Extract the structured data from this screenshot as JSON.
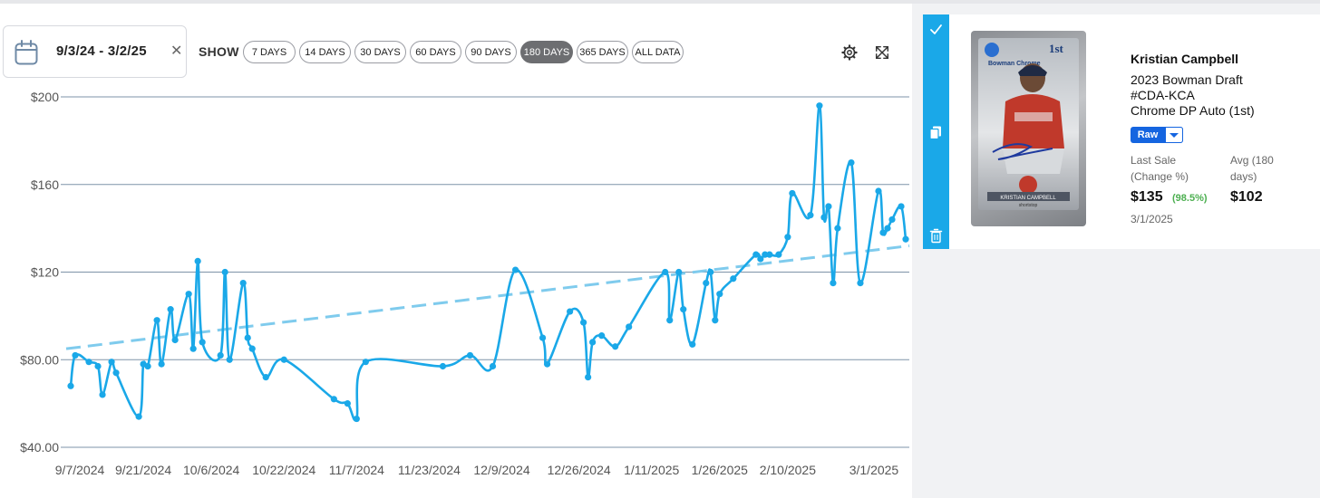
{
  "date_range": {
    "label": "9/3/24 - 3/2/25"
  },
  "filter": {
    "show_label": "SHOW",
    "options": [
      "7 DAYS",
      "14 DAYS",
      "30 DAYS",
      "60 DAYS",
      "90 DAYS",
      "180 DAYS",
      "365 DAYS",
      "ALL DATA"
    ],
    "selected": "180 DAYS"
  },
  "icons": {
    "calendar": "calendar-icon",
    "clear": "close-icon",
    "settings": "gear-icon",
    "expand": "expand-icon",
    "check": "check-icon",
    "copy": "copy-icon",
    "delete": "trash-icon"
  },
  "colors": {
    "line": "#1aa8e8",
    "trend": "#7fcbed",
    "grid": "#7e93a8",
    "accent_bar": "#1aa8e8",
    "raw_button": "#1565e0",
    "change_positive": "#4caf50"
  },
  "chart_data": {
    "type": "line",
    "title": "",
    "xlabel": "",
    "ylabel": "",
    "ylim": [
      40,
      200
    ],
    "yticks": [
      "$40.00",
      "$80.00",
      "$120",
      "$160",
      "$200"
    ],
    "yticks_values": [
      40,
      80,
      120,
      160,
      200
    ],
    "xlim": [
      "2024-09-04",
      "2025-03-04"
    ],
    "xticks": [
      "9/7/2024",
      "9/21/2024",
      "10/6/2024",
      "10/22/2024",
      "11/7/2024",
      "11/23/2024",
      "12/9/2024",
      "12/26/2024",
      "1/11/2025",
      "1/26/2025",
      "2/10/2025",
      "3/1/2025"
    ],
    "xticks_dates": [
      "2024-09-07",
      "2024-09-21",
      "2024-10-06",
      "2024-10-22",
      "2024-11-07",
      "2024-11-23",
      "2024-12-09",
      "2024-12-26",
      "2025-01-11",
      "2025-01-26",
      "2025-02-10",
      "2025-03-01"
    ],
    "grid": true,
    "series": [
      {
        "values": [
          [
            "2024-09-05",
            68
          ],
          [
            "2024-09-06",
            82
          ],
          [
            "2024-09-09",
            79
          ],
          [
            "2024-09-11",
            77
          ],
          [
            "2024-09-12",
            64
          ],
          [
            "2024-09-14",
            79
          ],
          [
            "2024-09-15",
            74
          ],
          [
            "2024-09-20",
            54
          ],
          [
            "2024-09-21",
            78
          ],
          [
            "2024-09-22",
            77
          ],
          [
            "2024-09-24",
            98
          ],
          [
            "2024-09-25",
            78
          ],
          [
            "2024-09-27",
            103
          ],
          [
            "2024-09-28",
            89
          ],
          [
            "2024-10-01",
            110
          ],
          [
            "2024-10-02",
            85
          ],
          [
            "2024-10-03",
            125
          ],
          [
            "2024-10-04",
            88
          ],
          [
            "2024-10-08",
            82
          ],
          [
            "2024-10-09",
            120
          ],
          [
            "2024-10-10",
            80
          ],
          [
            "2024-10-13",
            115
          ],
          [
            "2024-10-14",
            90
          ],
          [
            "2024-10-15",
            85
          ],
          [
            "2024-10-18",
            72
          ],
          [
            "2024-10-22",
            80
          ],
          [
            "2024-11-02",
            62
          ],
          [
            "2024-11-05",
            60
          ],
          [
            "2024-11-07",
            53
          ],
          [
            "2024-11-09",
            79
          ],
          [
            "2024-11-26",
            77
          ],
          [
            "2024-12-02",
            82
          ],
          [
            "2024-12-07",
            77
          ],
          [
            "2024-12-12",
            121
          ],
          [
            "2024-12-18",
            90
          ],
          [
            "2024-12-19",
            78
          ],
          [
            "2024-12-24",
            102
          ],
          [
            "2024-12-27",
            97
          ],
          [
            "2024-12-28",
            72
          ],
          [
            "2024-12-29",
            88
          ],
          [
            "2024-12-31",
            91
          ],
          [
            "2025-01-03",
            86
          ],
          [
            "2025-01-06",
            95
          ],
          [
            "2025-01-14",
            120
          ],
          [
            "2025-01-15",
            98
          ],
          [
            "2025-01-17",
            120
          ],
          [
            "2025-01-18",
            103
          ],
          [
            "2025-01-20",
            87
          ],
          [
            "2025-01-23",
            115
          ],
          [
            "2025-01-24",
            120
          ],
          [
            "2025-01-25",
            98
          ],
          [
            "2025-01-26",
            110
          ],
          [
            "2025-01-29",
            117
          ],
          [
            "2025-02-03",
            128
          ],
          [
            "2025-02-04",
            126
          ],
          [
            "2025-02-05",
            128
          ],
          [
            "2025-02-06",
            128
          ],
          [
            "2025-02-08",
            128
          ],
          [
            "2025-02-10",
            136
          ],
          [
            "2025-02-11",
            156
          ],
          [
            "2025-02-15",
            146
          ],
          [
            "2025-02-17",
            196
          ],
          [
            "2025-02-18",
            145
          ],
          [
            "2025-02-19",
            150
          ],
          [
            "2025-02-20",
            115
          ],
          [
            "2025-02-21",
            140
          ],
          [
            "2025-02-24",
            170
          ],
          [
            "2025-02-26",
            115
          ],
          [
            "2025-03-02",
            157
          ],
          [
            "2025-03-03",
            138
          ],
          [
            "2025-03-04",
            140
          ],
          [
            "2025-03-05",
            144
          ],
          [
            "2025-03-07",
            150
          ],
          [
            "2025-03-08",
            135
          ]
        ]
      }
    ],
    "trendline": {
      "start": [
        "2024-09-04",
        85
      ],
      "end": [
        "2025-03-09",
        132
      ]
    }
  },
  "card": {
    "player": "Kristian Campbell",
    "product_lines": [
      "2023 Bowman Draft",
      "#CDA-KCA",
      "Chrome DP Auto (1st)"
    ],
    "grade_button": "Raw",
    "last_sale_label": "Last Sale (Change %)",
    "avg_label": "Avg (180 days)",
    "last_sale_value": "$135",
    "change": "(98.5%)",
    "avg_value": "$102",
    "sale_date": "3/1/2025",
    "image_text": {
      "logo": "Bowman Chrome",
      "first": "1st BOWMAN",
      "nameplate": "KRISTIAN CAMPBELL",
      "position": "shortstop",
      "topps": "TOPPS CERTIFIED",
      "auto": "AUTOGRAPH ISSUE"
    }
  }
}
